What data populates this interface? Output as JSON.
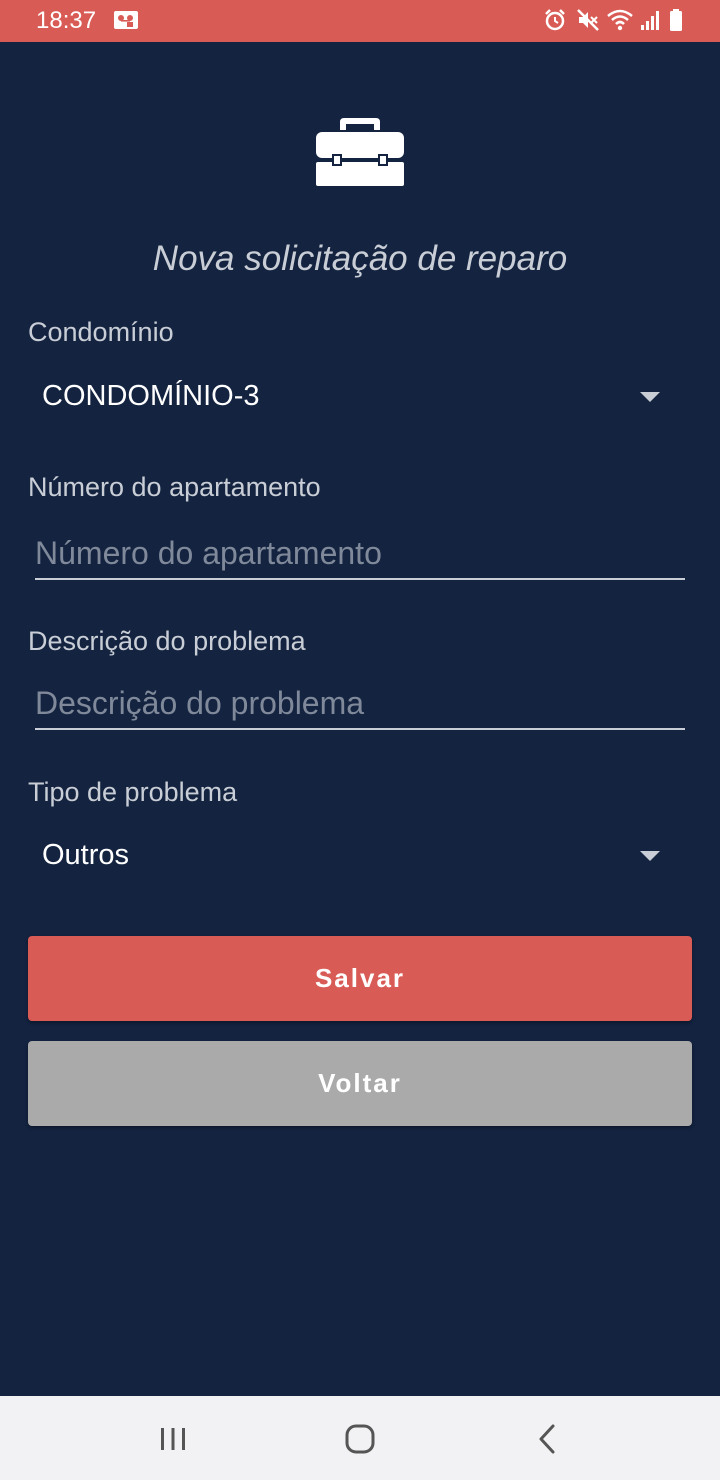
{
  "status_bar": {
    "time": "18:37",
    "icons": [
      "voicemail-icon",
      "alarm-icon",
      "mute-icon",
      "wifi-icon",
      "signal-icon",
      "battery-icon"
    ]
  },
  "header": {
    "icon": "toolbox-icon",
    "title": "Nova solicitação de reparo"
  },
  "form": {
    "condominio": {
      "label": "Condomínio",
      "value": "CONDOMÍNIO-3"
    },
    "apartamento": {
      "label": "Número do apartamento",
      "placeholder": "Número do apartamento",
      "value": ""
    },
    "descricao": {
      "label": "Descrição do problema",
      "placeholder": "Descrição do problema",
      "value": ""
    },
    "tipo": {
      "label": "Tipo de problema",
      "value": "Outros"
    }
  },
  "buttons": {
    "save_label": "Salvar",
    "back_label": "Voltar"
  },
  "nav_bar": {
    "icons": [
      "recent-apps-icon",
      "home-icon",
      "back-icon"
    ]
  },
  "colors": {
    "background": "#132340",
    "accent": "#d95b55",
    "secondary_button": "#aaaaaa"
  }
}
